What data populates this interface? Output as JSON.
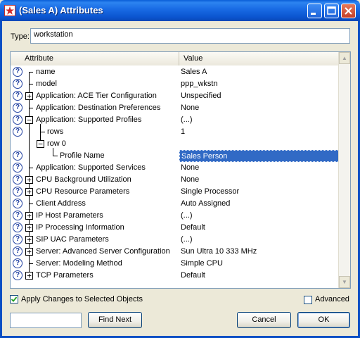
{
  "window": {
    "title": "(Sales A) Attributes"
  },
  "type_field": {
    "label": "Type:",
    "value": "workstation"
  },
  "table": {
    "headers": {
      "attribute": "Attribute",
      "value": "Value"
    },
    "rows": [
      {
        "attribute": "name",
        "value": "Sales A"
      },
      {
        "attribute": "model",
        "value": "ppp_wkstn"
      },
      {
        "attribute": "Application: ACE Tier Configuration",
        "value": "Unspecified"
      },
      {
        "attribute": "Application: Destination Preferences",
        "value": "None"
      },
      {
        "attribute": "Application: Supported Profiles",
        "value": "(...)"
      },
      {
        "attribute": "rows",
        "value": "1"
      },
      {
        "attribute": "row 0",
        "value": ""
      },
      {
        "attribute": "Profile Name",
        "value": "Sales Person"
      },
      {
        "attribute": "Application: Supported Services",
        "value": "None"
      },
      {
        "attribute": "CPU Background Utilization",
        "value": "None"
      },
      {
        "attribute": "CPU Resource Parameters",
        "value": "Single Processor"
      },
      {
        "attribute": "Client Address",
        "value": "Auto Assigned"
      },
      {
        "attribute": "IP Host Parameters",
        "value": "(...)"
      },
      {
        "attribute": "IP Processing Information",
        "value": "Default"
      },
      {
        "attribute": "SIP UAC Parameters",
        "value": "(...)"
      },
      {
        "attribute": "Server: Advanced Server Configuration",
        "value": "Sun Ultra 10 333 MHz"
      },
      {
        "attribute": "Server: Modeling Method",
        "value": "Simple CPU"
      },
      {
        "attribute": "TCP Parameters",
        "value": "Default"
      }
    ]
  },
  "apply_changes": {
    "label": "Apply Changes to Selected Objects",
    "checked": true
  },
  "advanced": {
    "label": "Advanced",
    "checked": false
  },
  "find": {
    "value": "",
    "button_label": "Find Next"
  },
  "buttons": {
    "cancel": "Cancel",
    "ok": "OK"
  },
  "colors": {
    "title_bar": "#1a6de6",
    "selection": "#316ac5",
    "dialog_bg": "#ece9d8"
  }
}
